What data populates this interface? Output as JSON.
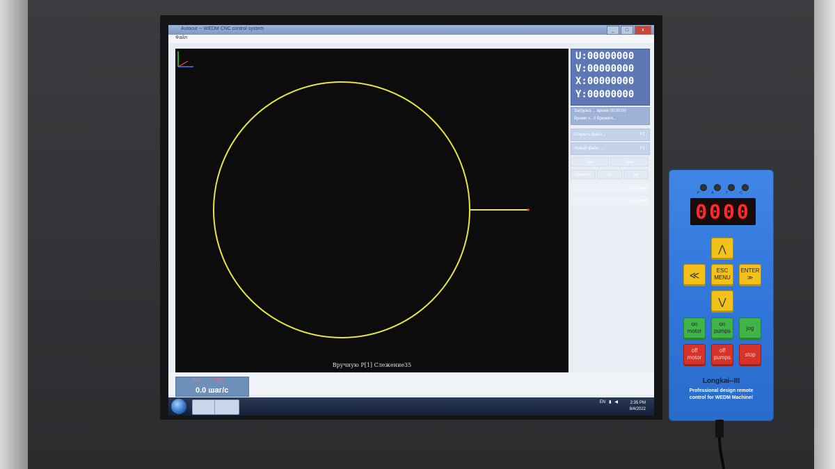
{
  "app": {
    "title_text": "Autocut ─ WEDM CNC control system",
    "menu_text": "Файл"
  },
  "window_buttons": [
    "_",
    "□",
    "x"
  ],
  "canvas": {
    "status_text": "Вручную P[1] Слежение35",
    "shape_color": "#e8e83a",
    "marker_color": "#ff3b3b"
  },
  "coordinates": {
    "u": "U:00000000",
    "v": "V:00000000",
    "x": "X:00000000",
    "y": "Y:00000000"
  },
  "info": {
    "line1": "Загрузка ... время 00:00:00",
    "line2": "Время ч.. 0 Время/ч..."
  },
  "side_menu": [
    {
      "label": "Открыть файл...",
      "key": "F2"
    },
    {
      "label": "Новый файл ...",
      "key": "F3"
    }
  ],
  "side_split": [
    "Пуск",
    "Стоп"
  ],
  "side_split2": [
    "Скорость",
    "25",
    "мм"
  ],
  "side_faint": [
    "<1 0.0 шаг>",
    "<4 0.0 шаг>"
  ],
  "speed": {
    "top_label": "ШАГ",
    "arrow": "→ 20/02",
    "value": "0.0 шаг/с"
  },
  "taskbar": {
    "tray_lang": "EN",
    "time": "2:35 PM",
    "date": "8/4/2022"
  },
  "pendant": {
    "display": "0000",
    "led_labels": "P A T C",
    "btn_up": "⋀",
    "btn_left": "≪",
    "btn_esc_line1": "ESC",
    "btn_esc_line2": "MENU",
    "btn_enter_line1": "ENTER",
    "btn_enter_line2": "≫",
    "btn_down": "⋁",
    "btn_on_motor_1": "on",
    "btn_on_motor_2": "motor",
    "btn_on_pumps_1": "on",
    "btn_on_pumps_2": "pumps",
    "btn_jog": "jog",
    "btn_off_motor_1": "off",
    "btn_off_motor_2": "motor",
    "btn_off_pumps_1": "off",
    "btn_off_pumps_2": "pumps",
    "btn_stop": "stop",
    "brand": "Longkai--III",
    "subtitle_1": "Professional design remote",
    "subtitle_2": "control for WEDM Machine!"
  }
}
